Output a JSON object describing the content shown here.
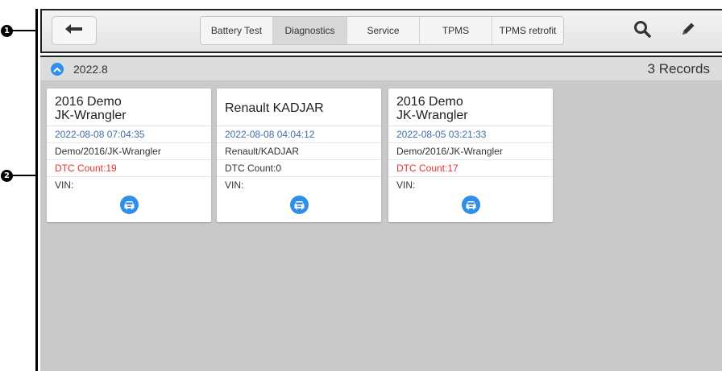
{
  "callouts": [
    "1",
    "2"
  ],
  "toolbar": {
    "tabs": [
      {
        "label": "Battery Test",
        "active": false
      },
      {
        "label": "Diagnostics",
        "active": true
      },
      {
        "label": "Service",
        "active": false
      },
      {
        "label": "TPMS",
        "active": false
      },
      {
        "label": "TPMS retrofit",
        "active": false
      }
    ],
    "icons": [
      "back-arrow-icon",
      "search-icon",
      "pencil-icon"
    ]
  },
  "group": {
    "title": "2022.8",
    "records": "3 Records"
  },
  "cards": [
    {
      "title": "2016 Demo\nJK-Wrangler",
      "date": "2022-08-08 07:04:35",
      "path": "Demo/2016/JK-Wrangler",
      "dtc": "DTC Count:19",
      "dtc_alert": true,
      "vin": "VIN:"
    },
    {
      "title": "Renault KADJAR",
      "date": "2022-08-08 04:04:12",
      "path": "Renault/KADJAR",
      "dtc": "DTC Count:0",
      "dtc_alert": false,
      "vin": "VIN:"
    },
    {
      "title": "2016 Demo\nJK-Wrangler",
      "date": "2022-08-05 03:21:33",
      "path": "Demo/2016/JK-Wrangler",
      "dtc": "DTC Count:17",
      "dtc_alert": true,
      "vin": "VIN:"
    }
  ],
  "colors": {
    "accent": "#2f8fe8",
    "alert": "#e5322d",
    "date": "#3d6ea6"
  }
}
